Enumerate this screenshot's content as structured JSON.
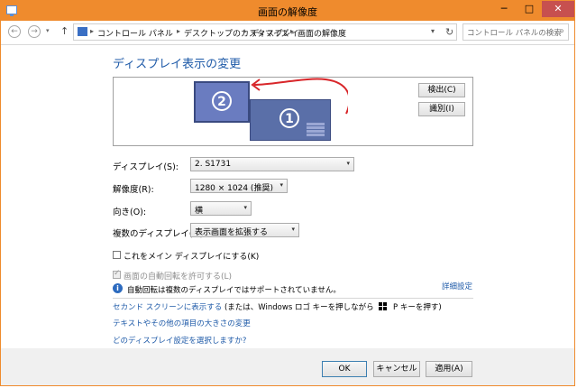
{
  "window": {
    "title": "画面の解像度",
    "min": "─",
    "max": "□",
    "close": "✕"
  },
  "nav": {
    "back": "←",
    "forward": "→",
    "dropdown": "▾",
    "up": "↑",
    "crumbs": [
      "コントロール パネル",
      "デスクトップのカスタマイズ",
      "ディスプレイ",
      "画面の解像度"
    ],
    "sep": "▸",
    "addr_chevron": "▾",
    "refresh": "↻",
    "search_placeholder": "コントロール パネルの検索",
    "search_icon": "⌕"
  },
  "heading": "ディスプレイ表示の変更",
  "preview": {
    "monitors": [
      {
        "number": "2"
      },
      {
        "number": "1"
      }
    ],
    "detect": "検出(C)",
    "identify": "識別(I)"
  },
  "settings": {
    "display": {
      "label": "ディスプレイ(S):",
      "value": "2. S1731"
    },
    "resolution": {
      "label": "解像度(R):",
      "value": "1280 × 1024 (推奨)"
    },
    "orientation": {
      "label": "向き(O):",
      "value": "横"
    },
    "multiple": {
      "label": "複数のディスプレイ(M):",
      "value": "表示画面を拡張する"
    },
    "select_arrow": "▾"
  },
  "main_display_checkbox": {
    "label": "これをメイン ディスプレイにする(K)",
    "checked": false
  },
  "auto_rotate_checkbox": {
    "label": "画面の自動回転を許可する(L)",
    "checked": true,
    "disabled": true
  },
  "info": {
    "icon": "i",
    "text": "自動回転は複数のディスプレイではサポートされていません。"
  },
  "advanced_link": "詳細設定",
  "links": {
    "second_screen": "セカンド スクリーンに表示する",
    "second_screen_suffix_a": " (または、Windows ロゴ キーを押しながら ",
    "second_screen_suffix_b": " P キーを押す)",
    "text_size": "テキストやその他の項目の大きさの変更",
    "which_setting": "どのディスプレイ設定を選択しますか?"
  },
  "buttons": {
    "ok": "OK",
    "cancel": "キャンセル",
    "apply": "適用(A)"
  },
  "colors": {
    "title_bar": "#ef8b2d",
    "link": "#1e5aa8",
    "close": "#c7504f",
    "arrow": "#d8262a"
  }
}
